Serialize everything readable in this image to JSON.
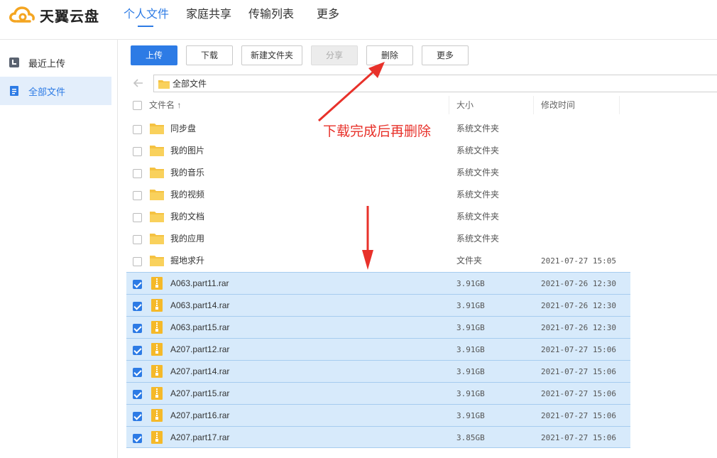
{
  "app": {
    "logo_text": "天翼云盘",
    "brand_color": "#2d7be5"
  },
  "nav": {
    "items": [
      {
        "label": "个人文件",
        "active": true
      },
      {
        "label": "家庭共享",
        "active": false
      },
      {
        "label": "传输列表",
        "active": false
      },
      {
        "label": "更多",
        "active": false
      }
    ]
  },
  "sidebar": {
    "items": [
      {
        "label": "最近上传",
        "icon": "recent-upload-icon"
      },
      {
        "label": "全部文件",
        "icon": "all-files-icon",
        "active": true
      }
    ]
  },
  "toolbar": {
    "upload": "上传",
    "download": "下载",
    "new_folder": "新建文件夹",
    "share": "分享",
    "delete": "删除",
    "more": "更多"
  },
  "breadcrumb": {
    "root": "全部文件"
  },
  "table": {
    "col_name": "文件名 ↑",
    "col_size": "大小",
    "col_time": "修改时间",
    "rows": [
      {
        "name": "同步盘",
        "size": "系统文件夹",
        "time": "",
        "type": "folder",
        "checked": false
      },
      {
        "name": "我的图片",
        "size": "系统文件夹",
        "time": "",
        "type": "folder",
        "checked": false
      },
      {
        "name": "我的音乐",
        "size": "系统文件夹",
        "time": "",
        "type": "folder",
        "checked": false
      },
      {
        "name": "我的视频",
        "size": "系统文件夹",
        "time": "",
        "type": "folder",
        "checked": false
      },
      {
        "name": "我的文档",
        "size": "系统文件夹",
        "time": "",
        "type": "folder",
        "checked": false
      },
      {
        "name": "我的应用",
        "size": "系统文件夹",
        "time": "",
        "type": "folder",
        "checked": false
      },
      {
        "name": "掘地求升",
        "size": "文件夹",
        "time": "2021-07-27 15:05",
        "type": "folder",
        "checked": false
      },
      {
        "name": "A063.part11.rar",
        "size": "3.91GB",
        "time": "2021-07-26 12:30",
        "type": "rar",
        "checked": true
      },
      {
        "name": "A063.part14.rar",
        "size": "3.91GB",
        "time": "2021-07-26 12:30",
        "type": "rar",
        "checked": true
      },
      {
        "name": "A063.part15.rar",
        "size": "3.91GB",
        "time": "2021-07-26 12:30",
        "type": "rar",
        "checked": true
      },
      {
        "name": "A207.part12.rar",
        "size": "3.91GB",
        "time": "2021-07-27 15:06",
        "type": "rar",
        "checked": true
      },
      {
        "name": "A207.part14.rar",
        "size": "3.91GB",
        "time": "2021-07-27 15:06",
        "type": "rar",
        "checked": true
      },
      {
        "name": "A207.part15.rar",
        "size": "3.91GB",
        "time": "2021-07-27 15:06",
        "type": "rar",
        "checked": true
      },
      {
        "name": "A207.part16.rar",
        "size": "3.91GB",
        "time": "2021-07-27 15:06",
        "type": "rar",
        "checked": true
      },
      {
        "name": "A207.part17.rar",
        "size": "3.85GB",
        "time": "2021-07-27 15:06",
        "type": "rar",
        "checked": true
      }
    ]
  },
  "annotation": {
    "text": "下载完成后再删除",
    "color": "#e8312a"
  }
}
